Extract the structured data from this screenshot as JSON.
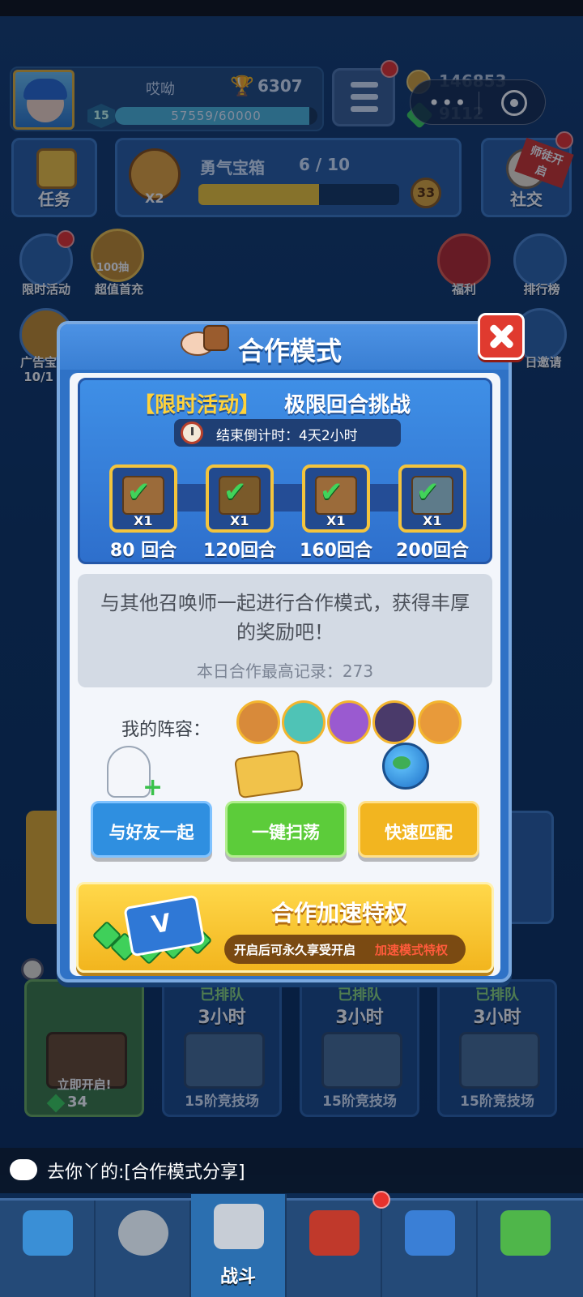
{
  "player": {
    "name": "哎呦",
    "trophies": "6307",
    "level": "15",
    "xp_text": "57559/60000",
    "xp_fraction": 0.959
  },
  "currency": {
    "coins": "146853",
    "gems": "9112"
  },
  "top_buttons": {
    "task_label": "任务",
    "social_label": "社交",
    "social_ribbon": "师徒开启"
  },
  "chest_progress": {
    "multiplier": "X2",
    "name": "勇气宝箱",
    "count": "6 / 10",
    "fraction": 0.6,
    "cost": "33"
  },
  "side_icons": {
    "limited_event": "限时活动",
    "first_recharge": "超值首充",
    "first_recharge_badge": "100抽",
    "welfare": "福利",
    "ranking": "排行榜",
    "ad_chest": "广告宝",
    "ad_chest_count": "10/1",
    "daily_invite": "日邀请"
  },
  "modal": {
    "title": "合作模式",
    "event": {
      "tag": "【限时活动】",
      "name": "极限回合挑战",
      "countdown": "结束倒计时：4天2小时",
      "rewards": [
        {
          "qty": "X1",
          "label": "80 回合",
          "done": true
        },
        {
          "qty": "X1",
          "label": "120回合",
          "done": true
        },
        {
          "qty": "X1",
          "label": "160回合",
          "done": true
        },
        {
          "qty": "X1",
          "label": "200回合",
          "done": true
        }
      ]
    },
    "description": "与其他召唤师一起进行合作模式，获得丰厚的奖励吧！",
    "record": "本日合作最高记录：273",
    "lineup_label": "我的阵容：",
    "buttons": {
      "with_friend": "与好友一起",
      "sweep": "一键扫荡",
      "quick_match": "快速匹配"
    },
    "vip": {
      "title": "合作加速特权",
      "sub_a": "开启后可永久享受开启",
      "sub_b": "加速模式特权",
      "card_letter": "V"
    }
  },
  "chest_slots": [
    {
      "status": "立即开启!",
      "gems": "34"
    },
    {
      "queued": "已排队",
      "time": "3小时",
      "arena": "15阶竞技场"
    },
    {
      "queued": "已排队",
      "time": "3小时",
      "arena": "15阶竞技场"
    },
    {
      "queued": "已排队",
      "time": "3小时",
      "arena": "15阶竞技场"
    }
  ],
  "chat": {
    "message": "去你丫的:[合作模式分享]"
  },
  "bottom_nav": {
    "active_label": "战斗"
  },
  "colors": {
    "accent_gold": "#f2c636",
    "modal_blue": "#2f72c6",
    "close_red": "#e03a2f",
    "queued_green": "#8ed97b"
  }
}
